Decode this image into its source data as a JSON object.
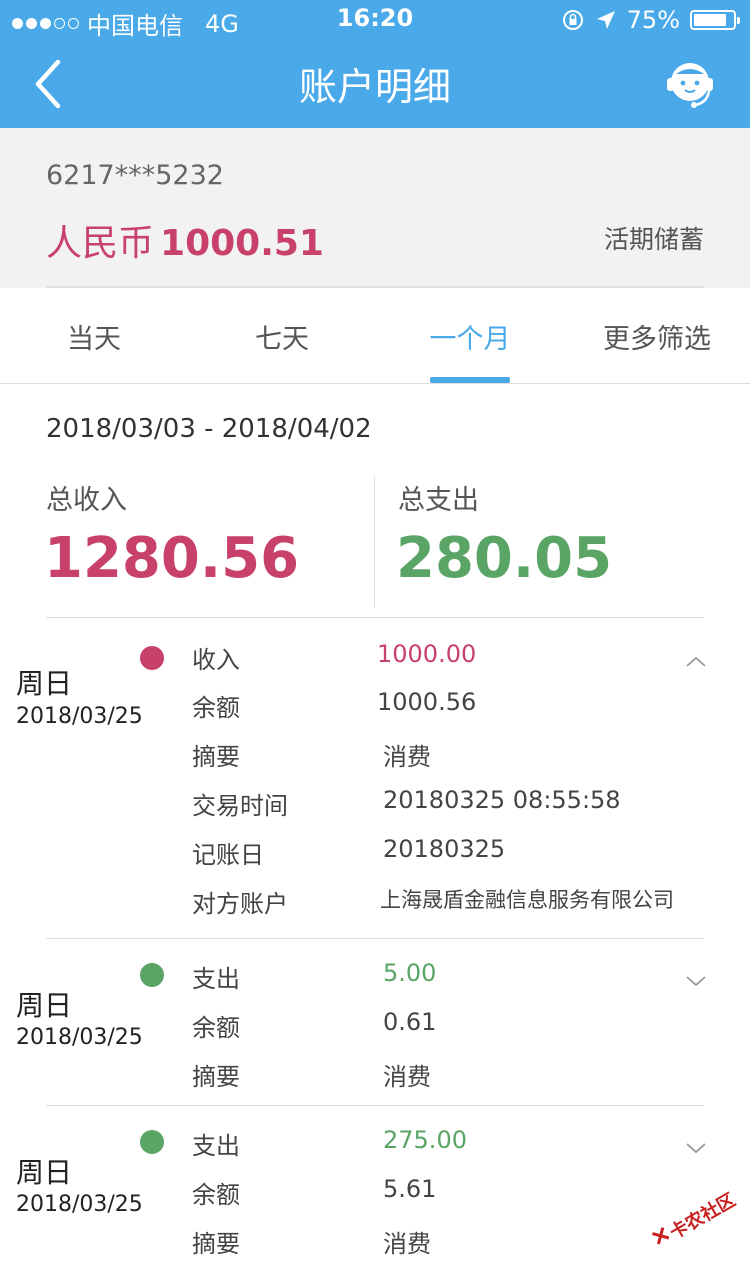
{
  "status_bar": {
    "carrier": "中国电信",
    "network": "4G",
    "time": "16:20",
    "battery": "75%",
    "signal_bars": 3
  },
  "nav": {
    "title": "账户明细",
    "back_icon": "chevron-left-icon",
    "service_icon": "customer-service-icon"
  },
  "account": {
    "number": "6217***5232",
    "currency": "人民币",
    "balance": "1000.51",
    "type": "活期储蓄"
  },
  "tabs": [
    {
      "label": "当天"
    },
    {
      "label": "七天"
    },
    {
      "label": "一个月",
      "active": true
    },
    {
      "label": "更多筛选"
    }
  ],
  "summary": {
    "range": "2018/03/03 - 2018/04/02",
    "income_label": "总收入",
    "income": "1280.56",
    "expense_label": "总支出",
    "expense": "280.05"
  },
  "transactions": [
    {
      "weekday": "周日",
      "date": "2018/03/25",
      "kind": "income",
      "expanded": true,
      "rows": [
        {
          "label": "收入",
          "value": "1000.00"
        },
        {
          "label": "余额",
          "value": "1000.56"
        },
        {
          "label": "摘要",
          "value": "消费"
        },
        {
          "label": "交易时间",
          "value": "20180325 08:55:58"
        },
        {
          "label": "记账日",
          "value": "20180325"
        },
        {
          "label": "对方账户",
          "value": "上海晟盾金融信息服务有限公司"
        }
      ]
    },
    {
      "weekday": "周日",
      "date": "2018/03/25",
      "kind": "expense",
      "expanded": false,
      "rows": [
        {
          "label": "支出",
          "value": "5.00"
        },
        {
          "label": "余额",
          "value": "0.61"
        },
        {
          "label": "摘要",
          "value": "消费"
        }
      ]
    },
    {
      "weekday": "周日",
      "date": "2018/03/25",
      "kind": "expense",
      "expanded": false,
      "rows": [
        {
          "label": "支出",
          "value": "275.00"
        },
        {
          "label": "余额",
          "value": "5.61"
        },
        {
          "label": "摘要",
          "value": "消费"
        }
      ]
    }
  ],
  "watermark": {
    "text": "卡农社区"
  },
  "colors": {
    "brand_blue": "#4aa9e9",
    "income_pink": "#c8416a",
    "expense_green": "#5aa565"
  }
}
